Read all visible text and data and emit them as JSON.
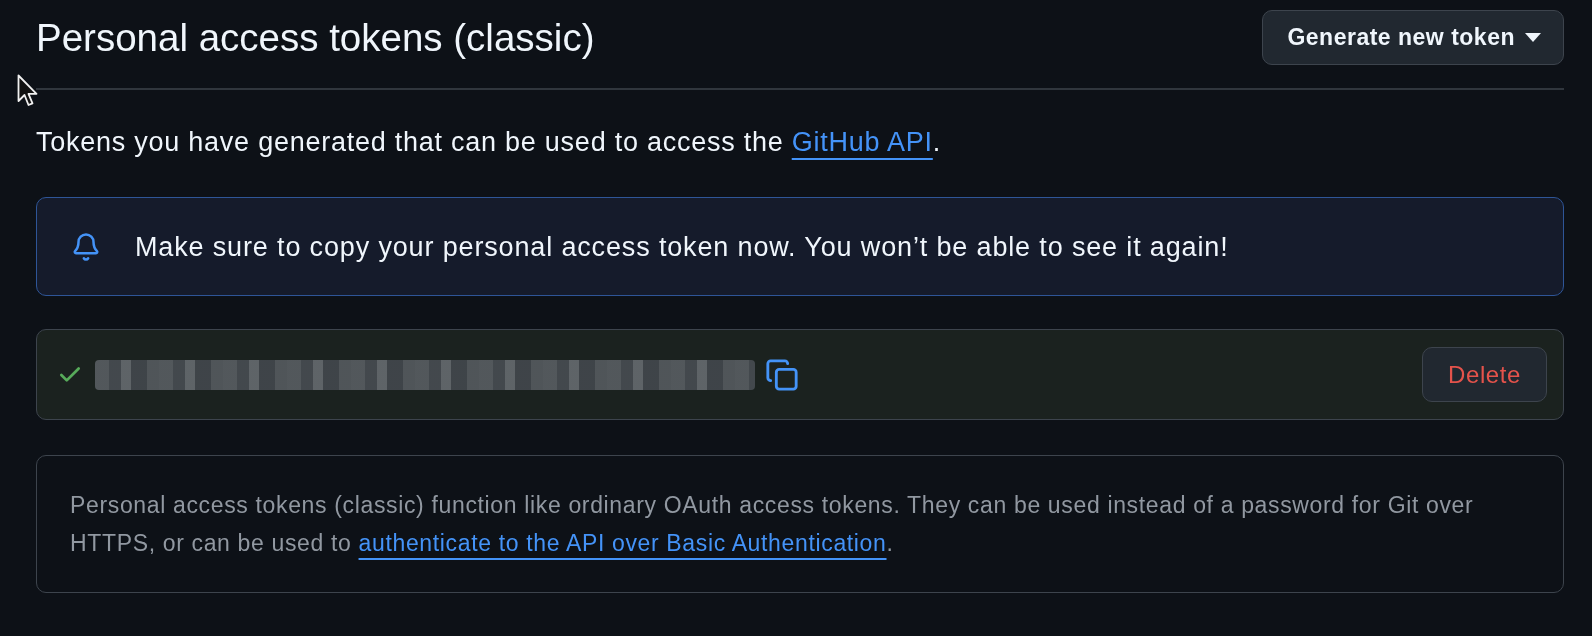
{
  "header": {
    "title": "Personal access tokens (classic)",
    "generate_button": {
      "label": "Generate new token"
    }
  },
  "intro": {
    "text": "Tokens you have generated that can be used to access the ",
    "link": "GitHub API",
    "suffix": "."
  },
  "flash": {
    "message": "Make sure to copy your personal access token now. You won’t be able to see it again!"
  },
  "tokens": [
    {
      "new": true,
      "delete_label": "Delete"
    }
  ],
  "note": {
    "text": "Personal access tokens (classic) function like ordinary OAuth access tokens. They can be used instead of a password for Git over HTTPS, or can be used to ",
    "link": "authenticate to the API over Basic Authentication",
    "suffix": "."
  }
}
